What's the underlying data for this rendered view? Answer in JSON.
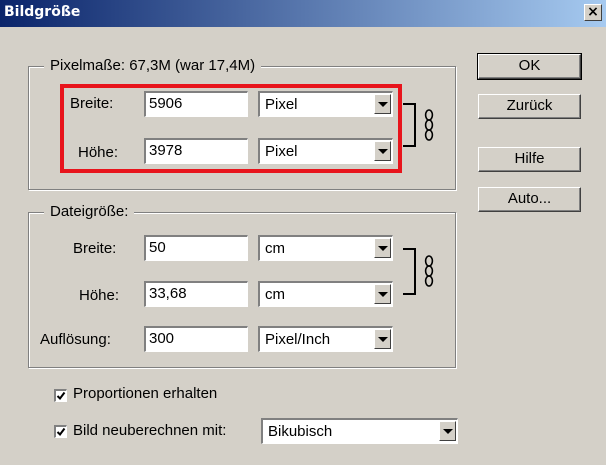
{
  "window": {
    "title": "Bildgröße",
    "close_glyph": "×"
  },
  "pixel_dims": {
    "legend": "Pixelmaße: 67,3M (war 17,4M)",
    "width": {
      "label": "Breite:",
      "value": "5906",
      "unit": "Pixel"
    },
    "height": {
      "label": "Höhe:",
      "value": "3978",
      "unit": "Pixel"
    }
  },
  "doc_size": {
    "legend": "Dateigröße:",
    "width": {
      "label": "Breite:",
      "value": "50",
      "unit": "cm"
    },
    "height": {
      "label": "Höhe:",
      "value": "33,68",
      "unit": "cm"
    },
    "resolution": {
      "label": "Auflösung:",
      "value": "300",
      "unit": "Pixel/Inch"
    }
  },
  "buttons": {
    "ok": "OK",
    "reset": "Zurück",
    "help": "Hilfe",
    "auto": "Auto..."
  },
  "options": {
    "constrain": {
      "label": "Proportionen erhalten",
      "checked": true
    },
    "resample": {
      "label": "Bild neuberechnen mit:",
      "checked": true,
      "method": "Bikubisch"
    }
  },
  "icons": {
    "link": "chain-link-icon",
    "dropdown": "triangle-down-icon",
    "check": "checkmark-icon"
  },
  "colors": {
    "highlight": "#e8141c",
    "title_start": "#0a246a",
    "title_end": "#a6caf0",
    "face": "#d4d0c8"
  }
}
